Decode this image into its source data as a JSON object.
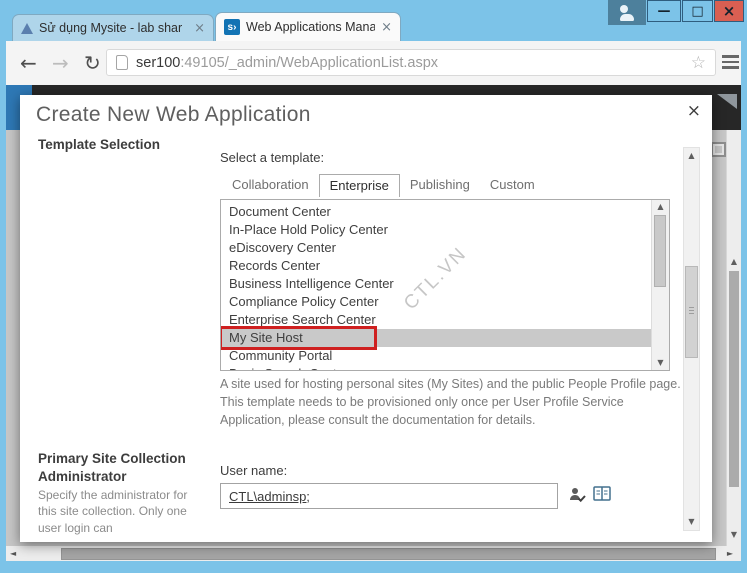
{
  "window": {
    "tabs": [
      {
        "title": "Sử dụng Mysite - lab shar"
      },
      {
        "title": "Web Applications Manage"
      }
    ]
  },
  "browser": {
    "url": {
      "host": "ser100",
      "path": ":49105/_admin/WebApplicationList.aspx"
    }
  },
  "icons": {
    "back": "←",
    "forward": "→",
    "reload": "↻",
    "bookmark_star": "☆",
    "tab_close": "×",
    "window_minimize": "—",
    "window_maximize": "□",
    "window_close": "×",
    "dialog_close": "×",
    "scroll_up": "▲",
    "scroll_down": "▼",
    "scroll_left": "◄",
    "scroll_right": "►",
    "sharepoint_logo": "s›"
  },
  "dialog": {
    "title": "Create New Web Application",
    "template_section": {
      "heading": "Template Selection",
      "select_label": "Select a template:",
      "tabs": [
        "Collaboration",
        "Enterprise",
        "Publishing",
        "Custom"
      ],
      "active_tab": "Enterprise",
      "items": [
        "Document Center",
        "In-Place Hold Policy Center",
        "eDiscovery Center",
        "Records Center",
        "Business Intelligence Center",
        "Compliance Policy Center",
        "Enterprise Search Center",
        "My Site Host",
        "Community Portal",
        "Basic Search Center"
      ],
      "selected_item": "My Site Host",
      "description": "A site used for hosting personal sites (My Sites) and the public People Profile page. This template needs to be provisioned only once per User Profile Service Application, please consult the documentation for details."
    },
    "admin_section": {
      "heading": "Primary Site Collection Administrator",
      "description": "Specify the administrator for this site collection. Only one user login can",
      "user_label": "User name:",
      "user_value": "CTL\\adminsp;"
    }
  },
  "watermark": "CTL.VN",
  "colors": {
    "titlebar": "#7cc3e8",
    "suitebar": "#272727",
    "suitebar_logo": "#2e78b5",
    "close_button": "#d95f52",
    "selection_highlight": "#c9c9c9",
    "annotation_red": "#cf2020",
    "page_background": "#c7c7c7"
  }
}
